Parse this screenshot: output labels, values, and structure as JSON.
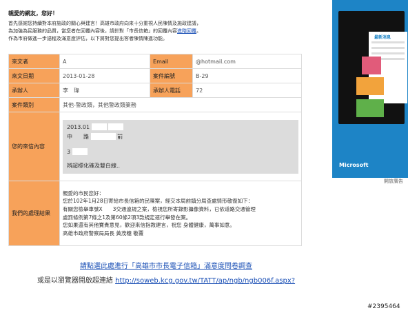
{
  "greeting": "親愛的網友，您好！",
  "intro": [
    "首先感謝您持續對本府施政的關心與建言！高雄市政府向來十分重視人民陳情及施政建議，",
    "為加強為民服務的品質，當您者在回覆內容後，請針對「市長信箱」的回覆內容",
    "作為市府做進一步語程及滿意度評估，以下將對您提出客者陳情陳進功能。"
  ],
  "intro_link": "進階回覆",
  "rows": {
    "sender_label": "來文者",
    "sender_value": "A",
    "email_label": "Email",
    "email_value": "@hotmail.com",
    "date_label": "來文日期",
    "date_value": "2013-01-28",
    "case_no_label": "案件編號",
    "case_no_value": "B-29",
    "officer_label": "承辦人",
    "officer_value": "李　瑋",
    "officer_phone_label": "承辦人電話",
    "officer_phone_value": "72",
    "category_label": "案件類別",
    "category_value": "其他-警政類，其他警政類業務",
    "content_label": "您的來信內容",
    "content_lines": [
      "2013.01",
      "中　　路",
      "3",
      "辨超標化確及雙白線.."
    ],
    "content_tail": "前",
    "result_label": "我們的處理結果"
  },
  "reply_lines": [
    "親愛的市民您好：",
    "您於102年1月28日寄給市長信箱的民陳案，經交本局前鎮分局查處情形敬復如下：",
    "有關您檢舉車號X　　3交通違規之案，檢視您所寄錄影攝像資料，已依道路交通管理",
    "處罰條例第7條之1及第60條2項3款規定逕行舉發在案。",
    "您如果還有其他寶貴意見，歡迎來信指教建言，祝您 身體健康，萬事如意。",
    "高雄市政府警察局局長 黃茂穗 敬覆"
  ],
  "bottom_link1": "請點選此處進行「高雄市市長電子信箱」滿意度問卷調查",
  "bottom_prefix": "或是以瀏覽器開啟超連結",
  "bottom_url": "http://soweb.kcg.gov.tw/TATT/ap/ngb/ngb006f.aspx?",
  "ad": {
    "brand": "Microsoft",
    "panel_title": "最新消息",
    "label": "開放廣告",
    "color": "#1d84c6"
  },
  "watermark": "#2395464"
}
